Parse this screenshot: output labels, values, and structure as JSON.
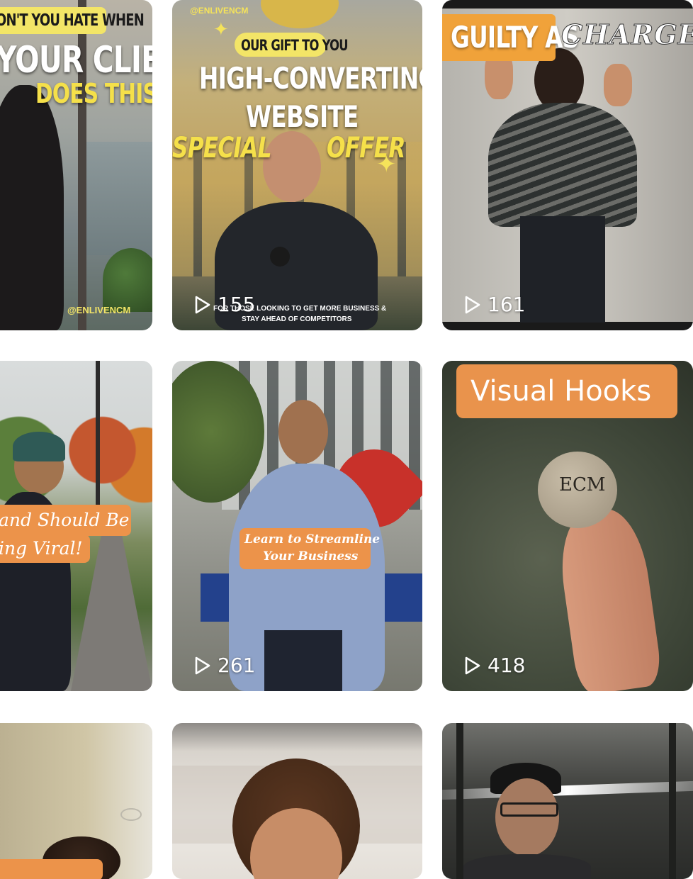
{
  "tiles": [
    {
      "id": "tile-1",
      "overlay": {
        "line1": "ON'T YOU HATE WHEN",
        "line2": "YOUR CLIENT",
        "line3": "DOES THIS?",
        "handle": "@ENLIVENCM"
      }
    },
    {
      "id": "tile-2",
      "plays": "155",
      "overlay": {
        "handle": "@ENLIVENCM",
        "badge": "OUR GIFT TO YOU",
        "headline1": "HIGH-CONVERTING",
        "headline2": "WEBSITE",
        "special": "SPECIAL",
        "offer": "OFFER",
        "footer1": "FOR THOSE LOOKING TO GET MORE BUSINESS &",
        "footer2": "STAY AHEAD OF COMPETITORS"
      }
    },
    {
      "id": "tile-3",
      "plays": "161",
      "overlay": {
        "guilty": "GUILTY AS",
        "charged": "CHARGED"
      }
    },
    {
      "id": "tile-4",
      "overlay": {
        "line1": "and Should Be",
        "line2": "ing Viral!"
      }
    },
    {
      "id": "tile-5",
      "plays": "261",
      "overlay": {
        "line1": "Learn to Streamline",
        "line2": "Your Business"
      }
    },
    {
      "id": "tile-6",
      "plays": "418",
      "overlay": {
        "title": "Visual Hooks",
        "stone": "ECM"
      }
    },
    {
      "id": "tile-7"
    },
    {
      "id": "tile-8"
    },
    {
      "id": "tile-9"
    }
  ],
  "icons": {
    "play": "play-icon"
  }
}
